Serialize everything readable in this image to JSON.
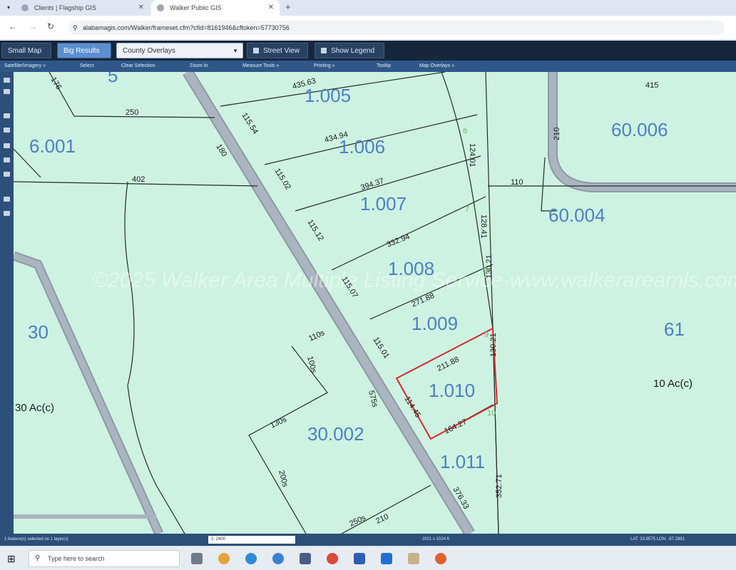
{
  "browser": {
    "tabs": [
      {
        "title": "Clients | Flagship GIS"
      },
      {
        "title": "Walker Public GIS"
      }
    ],
    "url": "alabamagis.com/Walker/frameset.cfm?cfid=8161946&cftoken=57730756"
  },
  "app_toolbar": {
    "small_map": "Small Map",
    "big_results": "Big Results",
    "county_overlays": "County Overlays",
    "street_view": "Street View",
    "show_legend": "Show Legend"
  },
  "map_tools": {
    "items": [
      "Satellite/Imagery »",
      "Select",
      "Clear Selection",
      "Zoom In",
      "Measure Tools »",
      "Printing »",
      "Tooltip",
      "Map Overlays »"
    ]
  },
  "map": {
    "watermark": "©2025 Walker Area Multiple Listing Service-www.walkerareamls.com",
    "parcel_ids": [
      "1.005",
      "1.006",
      "1.007",
      "1.008",
      "1.009",
      "1.010",
      "1.011",
      "6.001",
      "30",
      "30.002",
      "60.006",
      "60.004",
      "61",
      "5"
    ],
    "acreage_labels": [
      "30 Ac(c)",
      "10 Ac(c)"
    ],
    "dimensions": [
      "435.63",
      "434.94",
      "394.37",
      "332.94",
      "271.88",
      "211.88",
      "164.27",
      "115.54",
      "115.02",
      "115.12",
      "115.07",
      "115.01",
      "114.45",
      "124.01",
      "128.41",
      "130.21",
      "130.21",
      "352.71",
      "376.33",
      "402",
      "250",
      "180",
      "176",
      "415",
      "210",
      "110",
      "110s",
      "100s",
      "130s",
      "200s",
      "250s",
      "575s",
      "210"
    ],
    "lot_numbers": [
      "6",
      "7",
      "8",
      "9",
      "10"
    ],
    "selected_parcel": "1.010"
  },
  "status": {
    "selection": "1 feature(s) selected on 1 layer(s)",
    "scale": "1: 2400",
    "extent": "2021 x 1024 ft",
    "coords": "LAT: 33.8575 LON: -87.2981"
  },
  "taskbar": {
    "search_placeholder": "Type here to search"
  },
  "colors": {
    "parcel_fill": "#cdf2e1",
    "parcel_line": "#2a2a2a",
    "road": "#aab5bf",
    "selected": "#d32b2b",
    "label_blue": "#4d7fc4",
    "lot_green": "#6fb36d"
  }
}
